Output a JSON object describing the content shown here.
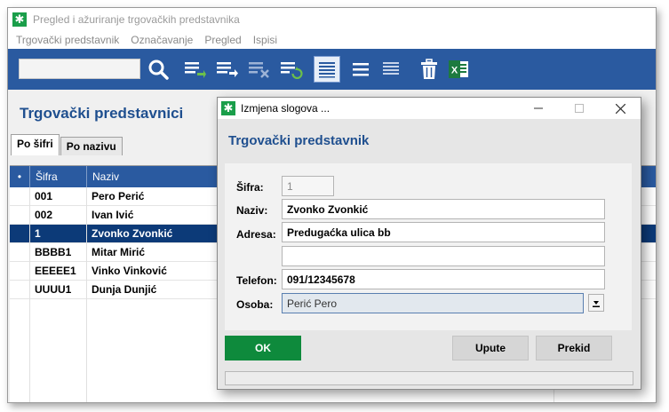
{
  "window": {
    "title": "Pregled i ažuriranje trgovačkih predstavnika"
  },
  "menu": {
    "items": [
      {
        "label": "Trgovački predstavnik"
      },
      {
        "label": "Označavanje"
      },
      {
        "label": "Pregled"
      },
      {
        "label": "Ispisi"
      }
    ]
  },
  "toolbar": {
    "search_value": "",
    "icons": [
      "search-icon",
      "list-add-icon",
      "list-edit-icon",
      "list-delete-icon",
      "list-refresh-icon",
      "view-list-icon",
      "view-compact-icon",
      "view-details-icon",
      "trash-icon",
      "excel-icon"
    ]
  },
  "page": {
    "title": "Trgovački predstavnici",
    "tabs": [
      {
        "label": "Po šifri",
        "active": true
      },
      {
        "label": "Po nazivu",
        "active": false
      }
    ]
  },
  "grid": {
    "columns": [
      "Šifra",
      "Naziv"
    ],
    "rows": [
      {
        "sifra": "001",
        "naziv": "Pero Perić",
        "selected": false
      },
      {
        "sifra": "002",
        "naziv": "Ivan Ivić",
        "selected": false
      },
      {
        "sifra": "1",
        "naziv": "Zvonko Zvonkić",
        "selected": true
      },
      {
        "sifra": "BBBB1",
        "naziv": "Mitar Mirić",
        "selected": false
      },
      {
        "sifra": "EEEEE1",
        "naziv": "Vinko Vinković",
        "selected": false
      },
      {
        "sifra": "UUUU1",
        "naziv": "Dunja Dunjić",
        "selected": false
      }
    ]
  },
  "dialog": {
    "title": "Izmjena slogova ...",
    "heading": "Trgovački predstavnik",
    "fields": {
      "sifra_label": "Šifra:",
      "sifra_value": "1",
      "naziv_label": "Naziv:",
      "naziv_value": "Zvonko Zvonkić",
      "adresa_label": "Adresa:",
      "adresa_value": "Predugaćka ulica bb",
      "adresa2_value": "",
      "telefon_label": "Telefon:",
      "telefon_value": "091/12345678",
      "osoba_label": "Osoba:",
      "osoba_value": "Perić Pero"
    },
    "buttons": {
      "ok": "OK",
      "upute": "Upute",
      "prekid": "Prekid"
    }
  },
  "colors": {
    "accent_blue": "#2a5aa0",
    "selected_row": "#0c3a78",
    "ok_green": "#0e8a3c",
    "heading_blue": "#1f4f8f"
  }
}
